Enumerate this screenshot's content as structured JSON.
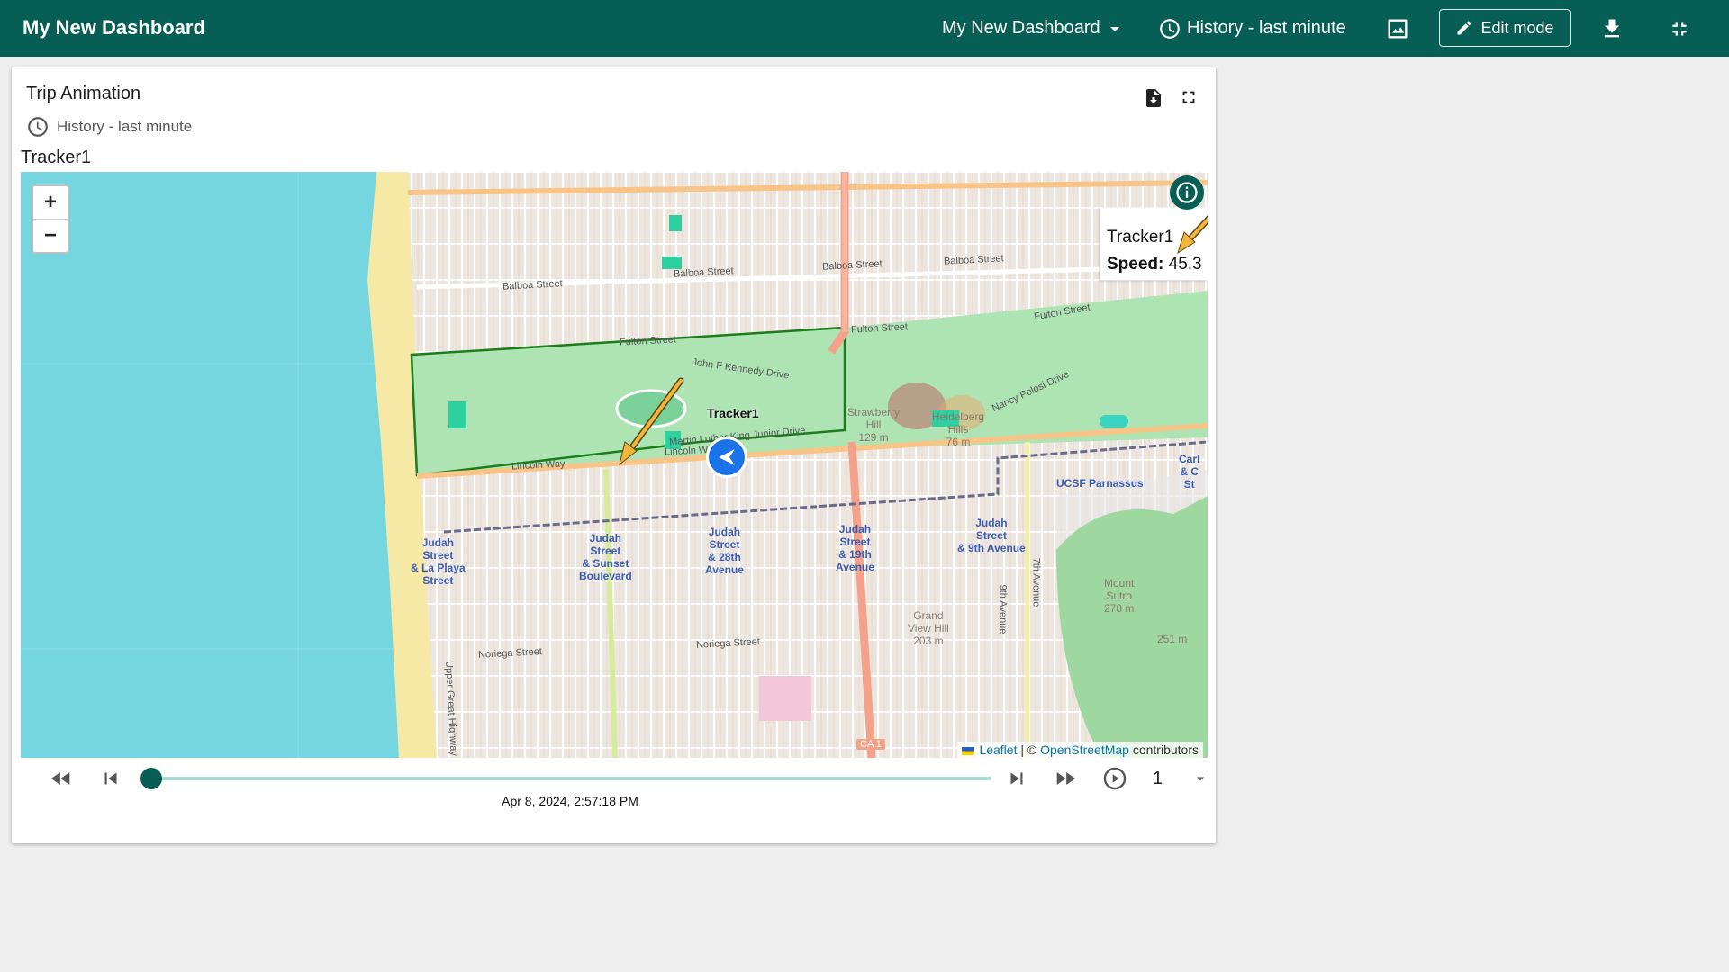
{
  "app": {
    "title": "My New Dashboard"
  },
  "toolbar": {
    "dashboard_select": "My New Dashboard",
    "timewindow": "History - last minute",
    "edit_mode": "Edit mode"
  },
  "widget": {
    "title": "Trip Animation",
    "timewindow": "History - last minute",
    "map_label": "Tracker1"
  },
  "map": {
    "tooltip": {
      "name": "Tracker1",
      "speed_label": "Speed:",
      "speed_value": "45.3"
    },
    "marker_label": "Tracker1",
    "zoom_in": "+",
    "zoom_out": "−",
    "attribution": {
      "leaflet": "Leaflet",
      "sep": " | © ",
      "osm": "OpenStreetMap",
      "suffix": " contributors"
    },
    "streets": {
      "balboa1": "Balboa Street",
      "balboa2": "Balboa Street",
      "balboa3": "Balboa Street",
      "balboa4": "Balboa Street",
      "fulton1": "Fulton Street",
      "fulton2": "Fulton Street",
      "fulton3": "Fulton Street",
      "jfk": "John F Kennedy Drive",
      "mlk": "Martin Luther King Junior Drive",
      "nancy": "Nancy Pelosi Drive",
      "lincoln1": "Lincoln Way",
      "lincoln2": "Lincoln Way",
      "noriega1": "Noriega Street",
      "noriega2": "Noriega Street",
      "ninth": "9th Avenue",
      "seventh": "7th Avenue",
      "great_hwy": "Upper Great Highway",
      "ca1": "CA 1"
    },
    "pois": {
      "strawberry": "Strawberry\nHill\n129 m",
      "heidelberg": "Heidelberg\nHills\n76 m",
      "grandview": "Grand\nView Hill\n203 m",
      "sutro": "Mount\nSutro\n278 m",
      "m251": "251 m",
      "ucsf": "UCSF Parnassus",
      "carl": "Carl\n& C\nSt",
      "judah_laplaya": "Judah\nStreet\n& La Playa\nStreet",
      "judah_sunset": "Judah\nStreet\n& Sunset\nBoulevard",
      "judah_28": "Judah\nStreet\n& 28th\nAvenue",
      "judah_19": "Judah\nStreet\n& 19th\nAvenue",
      "judah_9": "Judah\nStreet\n& 9th Avenue"
    }
  },
  "player": {
    "timestamp": "Apr 8, 2024, 2:57:18 PM",
    "speed": "1",
    "progress": 0.0
  },
  "colors": {
    "primary": "#075e54",
    "arrow": "#f5b53d",
    "marker": "#1a73e8",
    "park": "#aee4b4"
  }
}
